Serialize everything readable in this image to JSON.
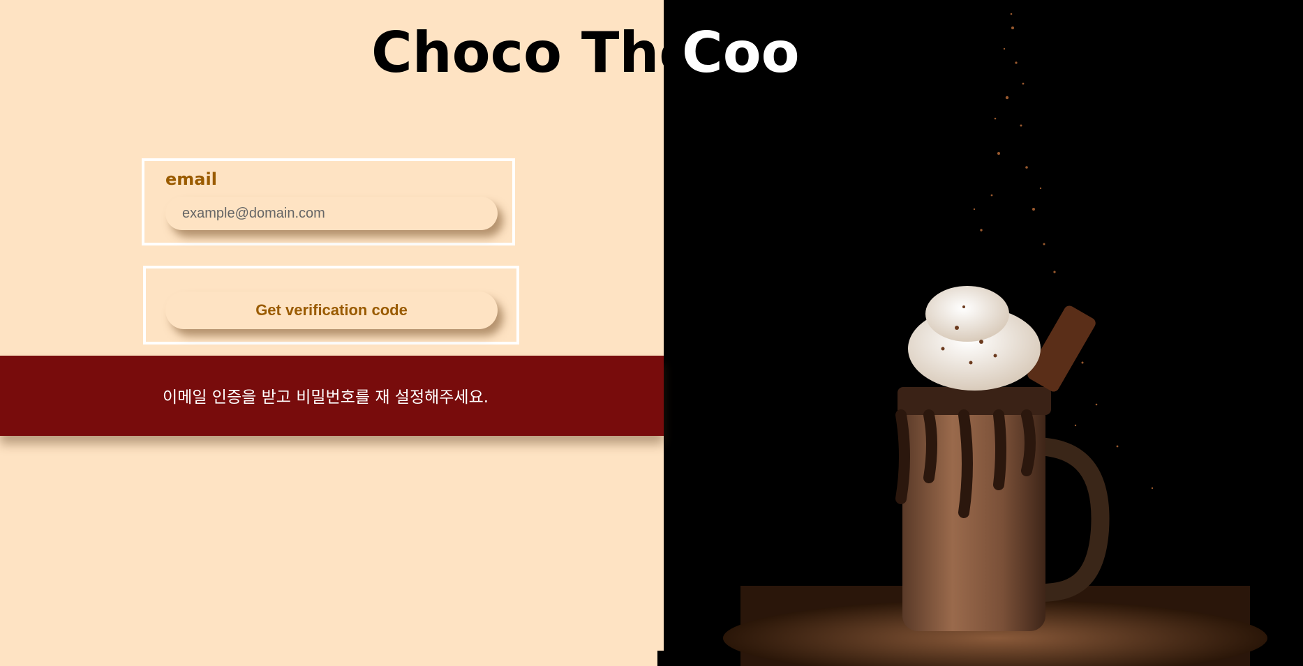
{
  "title": {
    "part_a": "Choco The",
    "part_b": "Coo"
  },
  "email": {
    "label": "email",
    "value": "",
    "placeholder": "example@domain.com"
  },
  "verify": {
    "button_label": "Get verification code"
  },
  "notice": {
    "text": "이메일 인증을 받고 비밀번호를 재 설정해주세요."
  },
  "colors": {
    "background": "#fee3c3",
    "accent_text": "#9a5b00",
    "notice_bg": "#780c0c",
    "photo_bg": "#000000"
  },
  "image": {
    "subject": "chocolate-milkshake-photo"
  }
}
